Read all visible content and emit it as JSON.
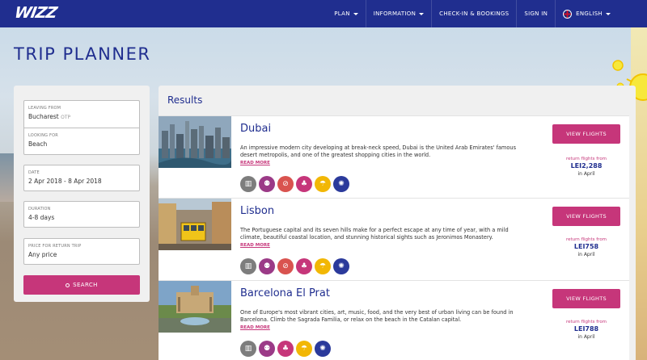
{
  "nav": {
    "logo": "WIZZ",
    "links": [
      "PLAN",
      "INFORMATION",
      "CHECK-IN & BOOKINGS",
      "SIGN IN",
      "ENGLISH"
    ]
  },
  "page_title": "TRIP PLANNER",
  "search": {
    "leaving_from": {
      "label": "LEAVING FROM",
      "value": "Bucharest",
      "code": "OTP"
    },
    "looking_for": {
      "label": "LOOKING FOR",
      "value": "Beach"
    },
    "date": {
      "label": "DATE",
      "value": "2 Apr 2018 - 8 Apr 2018"
    },
    "duration": {
      "label": "DURATION",
      "value": "4-8 days"
    },
    "price": {
      "label": "PRICE FOR RETURN TRIP",
      "value": "Any price"
    },
    "button": "SEARCH"
  },
  "results": {
    "title": "Results",
    "items": [
      {
        "name": "Dubai",
        "description": "An impressive modern city developing at break-neck speed, Dubai is the United Arab Emirates' famous desert metropolis, and one of the greatest shopping cities in the world.",
        "read_more": "READ MORE",
        "button": "VIEW FLIGHTS",
        "return_label": "return flights from",
        "price": "LEI2,288",
        "month": "in April",
        "icons": [
          "city-icon",
          "family-icon",
          "no-alcohol-icon",
          "party-icon",
          "beach-icon",
          "nightlife-icon"
        ]
      },
      {
        "name": "Lisbon",
        "description": "The Portuguese capital and its seven hills make for a perfect escape at any time of year, with a mild climate, beautiful coastal location, and stunning historical sights such as Jeronimos Monastery.",
        "read_more": "READ MORE",
        "button": "VIEW FLIGHTS",
        "return_label": "return flights from",
        "price": "LEI758",
        "month": "in April",
        "icons": [
          "city-icon",
          "family-icon",
          "no-alcohol-icon",
          "party-icon",
          "beach-icon",
          "nightlife-icon"
        ]
      },
      {
        "name": "Barcelona El Prat",
        "description": "One of Europe's most vibrant cities, art, music, food, and the very best of urban living can be found in Barcelona. Climb the Sagrada Familia, or relax on the beach in the Catalan capital.",
        "read_more": "READ MORE",
        "button": "VIEW FLIGHTS",
        "return_label": "return flights from",
        "price": "LEI788",
        "month": "in April",
        "icons": [
          "city-icon",
          "family-icon",
          "party-icon",
          "beach-icon",
          "nightlife-icon"
        ]
      }
    ]
  },
  "colors": {
    "brand_blue": "#202e8f",
    "brand_pink": "#c6367a",
    "icon_city": "#7d7d7d",
    "icon_family": "#9b3a87",
    "icon_no_alcohol": "#d9534f",
    "icon_party": "#c6367a",
    "icon_beach": "#f2b705",
    "icon_nightlife": "#2b3a9b"
  }
}
